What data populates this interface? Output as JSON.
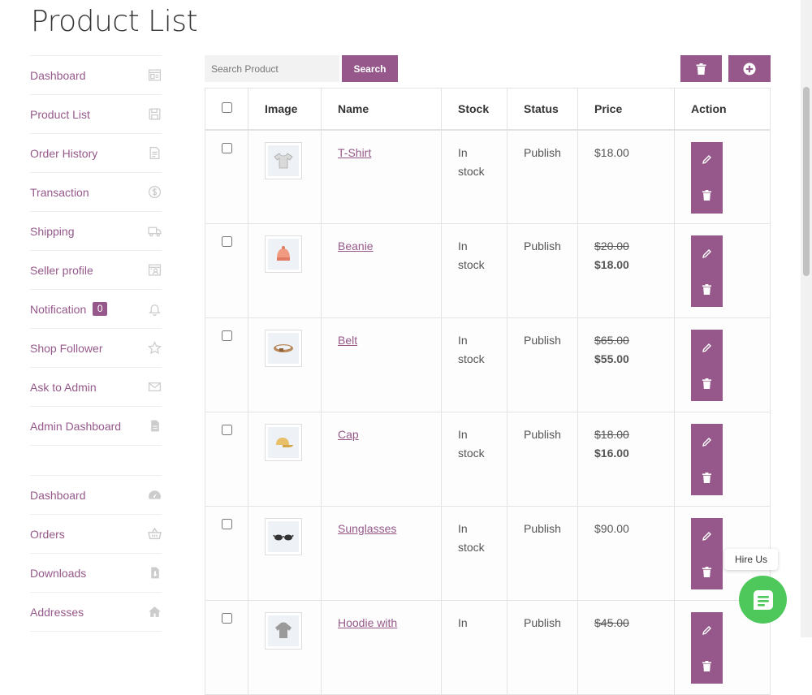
{
  "page": {
    "title": "Product List"
  },
  "colors": {
    "accent": "#96588a",
    "chat": "#4fc85b"
  },
  "sidebar": {
    "primary": [
      {
        "label": "Dashboard",
        "icon": "dashboard-icon"
      },
      {
        "label": "Product List",
        "icon": "save-icon"
      },
      {
        "label": "Order History",
        "icon": "document-icon"
      },
      {
        "label": "Transaction",
        "icon": "dollar-circle-icon"
      },
      {
        "label": "Shipping",
        "icon": "truck-icon"
      },
      {
        "label": "Seller profile",
        "icon": "profile-card-icon"
      },
      {
        "label": "Notification",
        "icon": "bell-icon",
        "badge": "0"
      },
      {
        "label": "Shop Follower",
        "icon": "star-icon"
      },
      {
        "label": "Ask to Admin",
        "icon": "envelope-icon"
      },
      {
        "label": "Admin Dashboard",
        "icon": "file-icon"
      }
    ],
    "secondary": [
      {
        "label": "Dashboard",
        "icon": "gauge-icon"
      },
      {
        "label": "Orders",
        "icon": "basket-icon"
      },
      {
        "label": "Downloads",
        "icon": "download-file-icon"
      },
      {
        "label": "Addresses",
        "icon": "home-icon"
      }
    ]
  },
  "toolbar": {
    "search_placeholder": "Search Product",
    "search_label": "Search"
  },
  "table": {
    "columns": [
      "Image",
      "Name",
      "Stock",
      "Status",
      "Price",
      "Action"
    ],
    "rows": [
      {
        "name": "T-Shirt",
        "stock": "In stock",
        "status": "Publish",
        "price": "$18.00",
        "price_old": "",
        "image": "tshirt-image"
      },
      {
        "name": "Beanie",
        "stock": "In stock",
        "status": "Publish",
        "price": "$18.00",
        "price_old": "$20.00",
        "image": "beanie-image"
      },
      {
        "name": "Belt",
        "stock": "In stock",
        "status": "Publish",
        "price": "$55.00",
        "price_old": "$65.00",
        "image": "belt-image"
      },
      {
        "name": "Cap",
        "stock": "In stock",
        "status": "Publish",
        "price": "$16.00",
        "price_old": "$18.00",
        "image": "cap-image"
      },
      {
        "name": "Sunglasses",
        "stock": "In stock",
        "status": "Publish",
        "price": "$90.00",
        "price_old": "",
        "image": "sunglasses-image"
      },
      {
        "name": "Hoodie with",
        "stock": "In",
        "status": "Publish",
        "price": "",
        "price_old": "$45.00",
        "image": "hoodie-image"
      }
    ]
  },
  "widget": {
    "hire_label": "Hire Us"
  }
}
